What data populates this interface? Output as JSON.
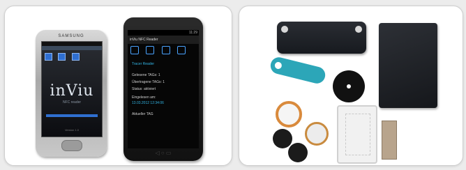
{
  "left_panel": {
    "samsung_phone": {
      "brand": "SAMSUNG",
      "logo": "inViu",
      "logo_sub": "NFC reader",
      "footer": "Version 1.0"
    },
    "nexus_phone": {
      "status_time": "11:29",
      "app_title": "inViu NFC Reader",
      "section_title": "Tracer Reader",
      "lines": [
        "Gelesene TAGs: 1",
        "Übertragene TAGs: 1",
        "Status: aktiviert",
        "Eingelesen am:",
        "13.03.2012 12:34:06",
        "Aktueller TAG"
      ],
      "nav_icons": "◁  ○  ▭"
    }
  },
  "right_panel": {
    "objects": [
      "large-tag",
      "card-tag",
      "key-fob",
      "disc-tag",
      "coil-tag",
      "sticker-tag",
      "button-tags",
      "clear-card",
      "small-tag"
    ]
  }
}
